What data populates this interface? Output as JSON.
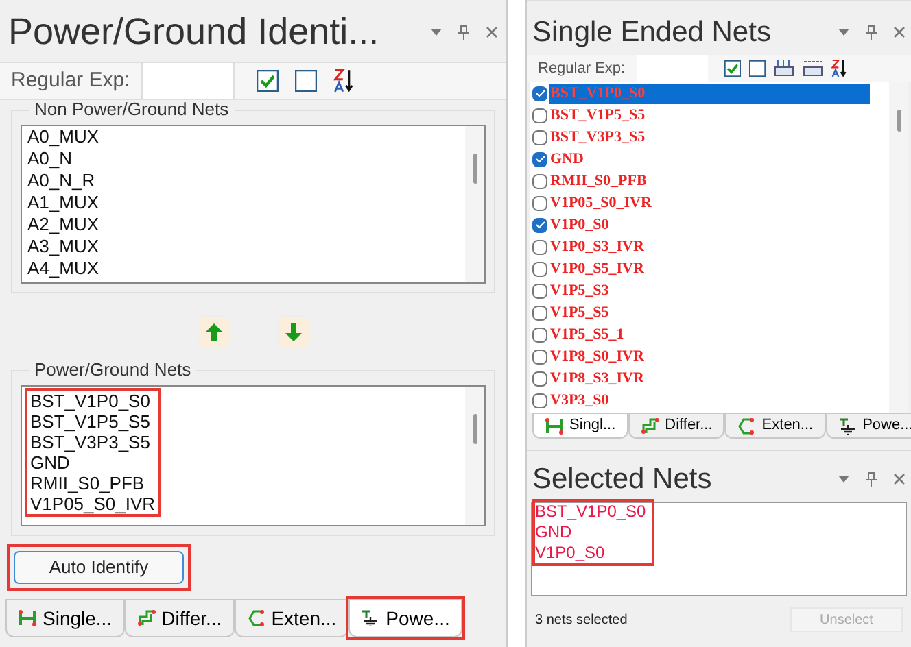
{
  "left_panel": {
    "title": "Power/Ground Identi...",
    "toolbar": {
      "label": "Regular Exp:"
    },
    "non_power_group": {
      "title": "Non Power/Ground Nets",
      "items": [
        "A0_MUX",
        "A0_N",
        "A0_N_R",
        "A1_MUX",
        "A2_MUX",
        "A3_MUX",
        "A4_MUX"
      ]
    },
    "power_group": {
      "title": "Power/Ground Nets",
      "highlighted": true,
      "items": [
        "BST_V1P0_S0",
        "BST_V1P5_S5",
        "BST_V3P3_S5",
        "GND",
        "RMII_S0_PFB",
        "V1P05_S0_IVR"
      ]
    },
    "auto_identify_button": {
      "label": "Auto Identify",
      "highlighted": true
    },
    "tabs": [
      {
        "kind": "single",
        "label": "Single...",
        "selected": false,
        "highlighted": false
      },
      {
        "kind": "diff",
        "label": "Differ...",
        "selected": false,
        "highlighted": false
      },
      {
        "kind": "ext",
        "label": "Exten...",
        "selected": false,
        "highlighted": false
      },
      {
        "kind": "power",
        "label": "Powe...",
        "selected": true,
        "highlighted": true
      }
    ]
  },
  "right_panel": {
    "title": "Single Ended Nets",
    "toolbar": {
      "label": "Regular Exp:"
    },
    "nets": [
      {
        "name": "BST_V1P0_S0",
        "checked": true,
        "selected": true
      },
      {
        "name": "BST_V1P5_S5",
        "checked": false,
        "selected": false
      },
      {
        "name": "BST_V3P3_S5",
        "checked": false,
        "selected": false
      },
      {
        "name": "GND",
        "checked": true,
        "selected": false
      },
      {
        "name": "RMII_S0_PFB",
        "checked": false,
        "selected": false
      },
      {
        "name": "V1P05_S0_IVR",
        "checked": false,
        "selected": false
      },
      {
        "name": "V1P0_S0",
        "checked": true,
        "selected": false
      },
      {
        "name": "V1P0_S3_IVR",
        "checked": false,
        "selected": false
      },
      {
        "name": "V1P0_S5_IVR",
        "checked": false,
        "selected": false
      },
      {
        "name": "V1P5_S3",
        "checked": false,
        "selected": false
      },
      {
        "name": "V1P5_S5",
        "checked": false,
        "selected": false
      },
      {
        "name": "V1P5_S5_1",
        "checked": false,
        "selected": false
      },
      {
        "name": "V1P8_S0_IVR",
        "checked": false,
        "selected": false
      },
      {
        "name": "V1P8_S3_IVR",
        "checked": false,
        "selected": false
      },
      {
        "name": "V3P3_S0",
        "checked": false,
        "selected": false
      }
    ],
    "tabs": [
      {
        "kind": "single",
        "label": "Singl...",
        "selected": true
      },
      {
        "kind": "diff",
        "label": "Differ...",
        "selected": false
      },
      {
        "kind": "ext",
        "label": "Exten...",
        "selected": false
      },
      {
        "kind": "power",
        "label": "Powe...",
        "selected": false
      }
    ]
  },
  "selected_nets_panel": {
    "title": "Selected Nets",
    "highlighted": true,
    "items": [
      "BST_V1P0_S0",
      "GND",
      "V1P0_S0"
    ],
    "status": "3 nets selected",
    "unselect_button": {
      "label": "Unselect",
      "disabled": true
    }
  }
}
